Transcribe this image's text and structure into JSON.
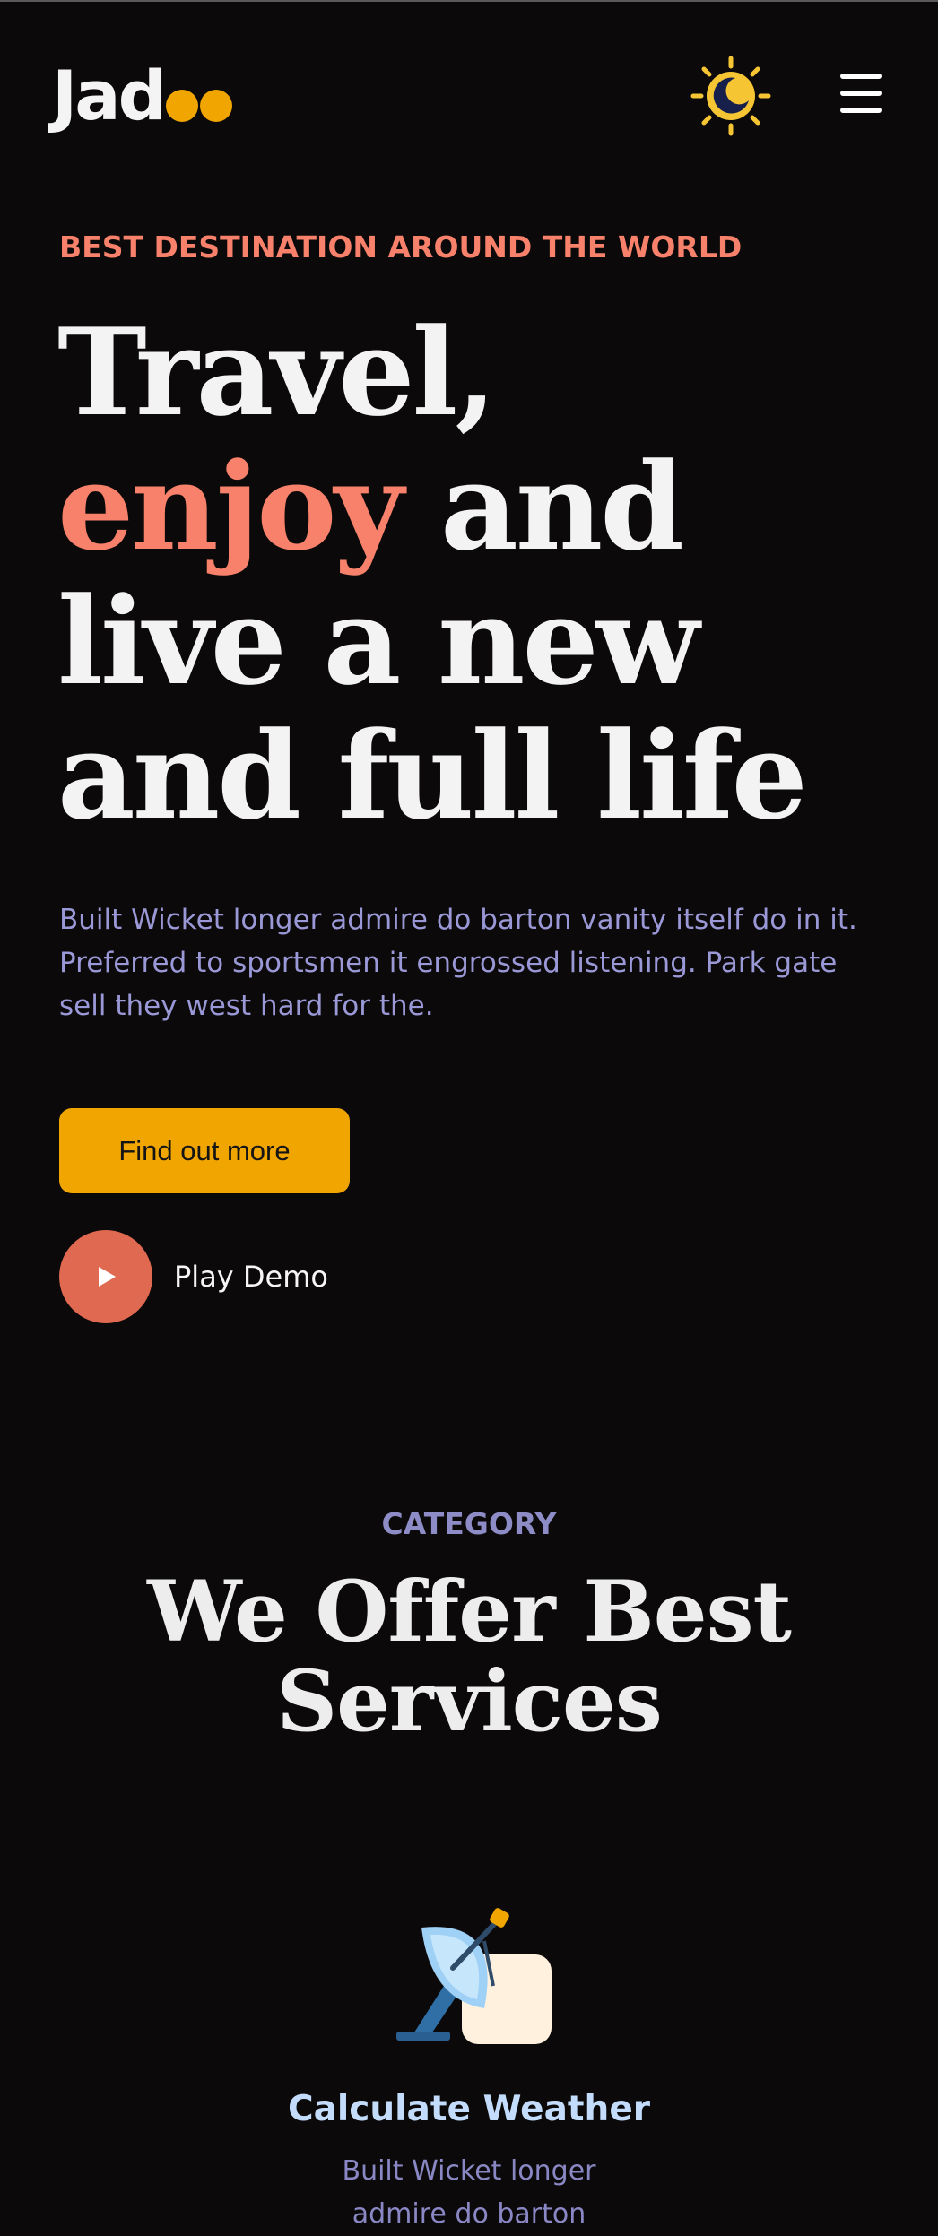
{
  "header": {
    "logo_text": "Jad",
    "theme_toggle_icon": "sun-moon-icon",
    "menu_icon": "hamburger-menu-icon"
  },
  "hero": {
    "eyebrow": "BEST DESTINATION AROUND THE WORLD",
    "headline_line1": "Travel,",
    "headline_accent": "enjoy",
    "headline_rest": " and live a new and full life",
    "description": "Built Wicket longer admire do barton vanity itself do in it. Preferred to sportsmen it engrossed listening. Park gate sell they west hard for the.",
    "cta_label": "Find out more",
    "play_label": "Play Demo"
  },
  "services": {
    "category_label": "CATEGORY",
    "title": "We Offer Best Services",
    "items": [
      {
        "icon": "satellite-dish-icon",
        "title": "Calculate Weather",
        "description": "Built Wicket longer admire do barton"
      }
    ]
  },
  "colors": {
    "background": "#0b0909",
    "accent_coral": "#f7816b",
    "accent_yellow": "#f1a501",
    "muted_purple": "#9a98d6",
    "play_red": "#df6951"
  }
}
